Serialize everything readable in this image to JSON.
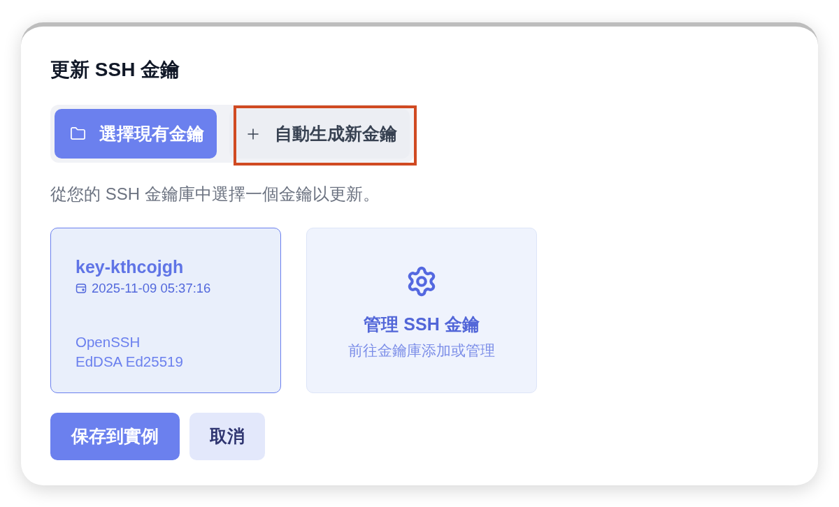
{
  "dialog": {
    "title": "更新 SSH 金鑰"
  },
  "tabs": [
    {
      "label": "選擇現有金鑰",
      "selected": true,
      "highlighted": false
    },
    {
      "label": "自動生成新金鑰",
      "selected": false,
      "highlighted": true
    }
  ],
  "description": "從您的 SSH 金鑰庫中選擇一個金鑰以更新。",
  "cards": [
    {
      "kind": "key",
      "name": "key-kthcojgh",
      "date": "2025-11-09 05:37:16",
      "format": "OpenSSH",
      "algorithm": "EdDSA Ed25519",
      "selected": true
    },
    {
      "kind": "manage",
      "title": "管理 SSH 金鑰",
      "subtitle": "前往金鑰庫添加或管理",
      "selected": false
    }
  ],
  "buttons": [
    {
      "label": "保存到實例",
      "kind": "primary"
    },
    {
      "label": "取消",
      "kind": "secondary"
    }
  ]
}
